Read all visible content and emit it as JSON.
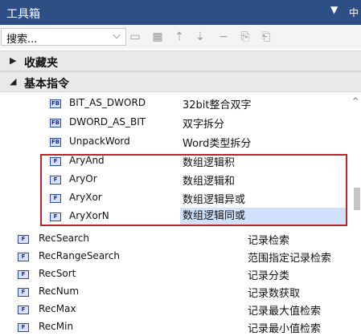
{
  "title": "工具箱",
  "title_dropdown_glyph": "▼",
  "title_pin_glyph": "中",
  "search": {
    "value": "搜索...",
    "chevron": "⌵"
  },
  "toolbar": [
    {
      "name": "folder-icon",
      "glyph": "▭"
    },
    {
      "name": "new-folder-icon",
      "glyph": "▦"
    },
    {
      "name": "move-up-icon",
      "glyph": "⇡"
    },
    {
      "name": "move-down-icon",
      "glyph": "⇣"
    },
    {
      "name": "remove-icon",
      "glyph": "−"
    },
    {
      "name": "import-icon",
      "glyph": "⎘"
    },
    {
      "name": "export-icon",
      "glyph": "⎗"
    }
  ],
  "sections": {
    "favorites": "收藏夹",
    "basic": "基本指令"
  },
  "top_items": [
    {
      "icon": "FB",
      "name": "BIT_AS_DWORD",
      "desc": "32bit整合双字"
    },
    {
      "icon": "FB",
      "name": "DWORD_AS_BIT",
      "desc": "双字拆分"
    },
    {
      "icon": "FB",
      "name": "UnpackWord",
      "desc": "Word类型拆分"
    },
    {
      "icon": "F",
      "name": "AryAnd",
      "desc": "数组逻辑积"
    },
    {
      "icon": "F",
      "name": "AryOr",
      "desc": "数组逻辑和"
    },
    {
      "icon": "F",
      "name": "AryXor",
      "desc": "数组逻辑异或"
    },
    {
      "icon": "F",
      "name": "AryXorN",
      "desc": "数组逻辑同或"
    }
  ],
  "bottom_items": [
    {
      "icon": "F",
      "name": "RecSearch",
      "desc": "记录检索"
    },
    {
      "icon": "F",
      "name": "RecRangeSearch",
      "desc": "范围指定记录检索"
    },
    {
      "icon": "F",
      "name": "RecSort",
      "desc": "记录分类"
    },
    {
      "icon": "F",
      "name": "RecNum",
      "desc": "记录数获取"
    },
    {
      "icon": "F",
      "name": "RecMax",
      "desc": "记录最大值检索"
    },
    {
      "icon": "F",
      "name": "RecMin",
      "desc": "记录最小值检索"
    }
  ],
  "colors": {
    "titlebar": "#2d4f86",
    "highlight": "#c0242b",
    "selected": "#cfe1fb"
  }
}
